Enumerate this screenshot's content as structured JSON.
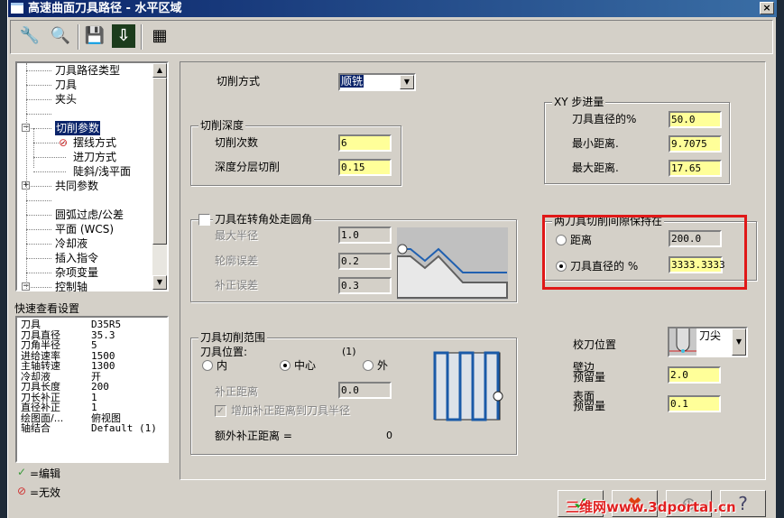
{
  "window": {
    "title": "高速曲面刀具路径 - 水平区域",
    "close": "×"
  },
  "toolbar": [
    {
      "icon": "tool-icon",
      "g": "🔧"
    },
    {
      "icon": "table-search-icon",
      "g": "🔍"
    },
    {
      "icon": "save-icon",
      "g": "💾"
    },
    {
      "icon": "save-load-icon",
      "g": "⇩"
    },
    {
      "icon": "calculator-icon",
      "g": "▦"
    }
  ],
  "tree": {
    "items": [
      "刀具路径类型",
      "刀具",
      "夹头",
      "",
      "切削参数",
      "摆线方式",
      "进刀方式",
      "陡斜/浅平面",
      "共同参数",
      "",
      "圆弧过虑/公差",
      "平面 (WCS)",
      "冷却液",
      "插入指令",
      "杂项变量",
      "控制轴"
    ]
  },
  "quick": {
    "title": "快速查看设置",
    "rows": [
      [
        "刀具",
        "D35R5"
      ],
      [
        "刀具直径",
        "35.3"
      ],
      [
        "刀角半径",
        "5"
      ],
      [
        "进给速率",
        "1500"
      ],
      [
        "主轴转速",
        "1300"
      ],
      [
        "冷却液",
        "开"
      ],
      [
        "刀具长度",
        "200"
      ],
      [
        "刀长补正",
        "1"
      ],
      [
        "直径补正",
        "1"
      ],
      [
        "绘图面/...",
        "俯视图"
      ],
      [
        "轴结合",
        "Default (1)"
      ]
    ]
  },
  "legend": {
    "edit": "=编辑",
    "invalid": "=无效"
  },
  "cut": {
    "method_label": "切削方式",
    "method_value": "顺铣"
  },
  "depth": {
    "title": "切削深度",
    "count_label": "切削次数",
    "count": "6",
    "step_label": "深度分层切削",
    "step": "0.15"
  },
  "corner": {
    "title": "刀具在转角处走圆角",
    "max_radius_label": "最大半径",
    "max_radius": "1.0",
    "profile_tol_label": "轮廓误差",
    "profile_tol": "0.2",
    "offset_tol_label": "补正误差",
    "offset_tol": "0.3"
  },
  "range": {
    "title": "刀具切削范围",
    "pos_label": "刀具位置:",
    "pos_num": "(1)",
    "inside": "内",
    "center": "中心",
    "outside": "外",
    "offset_label": "补正距离",
    "offset": "0.0",
    "add_label": "增加补正距离到刀具半径",
    "extra_label": "额外补正距离 =",
    "extra": "0"
  },
  "xy": {
    "title": "XY 步进量",
    "pct_label": "刀具直径的%",
    "pct": "50.0",
    "min_label": "最小距离.",
    "min": "9.7075",
    "max_label": "最大距离.",
    "max": "17.65"
  },
  "gap": {
    "title": "两刀具切削间隙保持在",
    "dist_label": "距离",
    "dist": "200.0",
    "pct_label": "刀具直径的 %",
    "pct": "3333.3333"
  },
  "calib": {
    "label": "校刀位置",
    "value": "刀尖"
  },
  "stock": {
    "wall_l1": "壁边",
    "wall_l2": "预留量",
    "wall": "2.0",
    "floor_l1": "表面",
    "floor_l2": "预留量",
    "floor": "0.1"
  },
  "watermark": "三维网www.3dportal.cn"
}
